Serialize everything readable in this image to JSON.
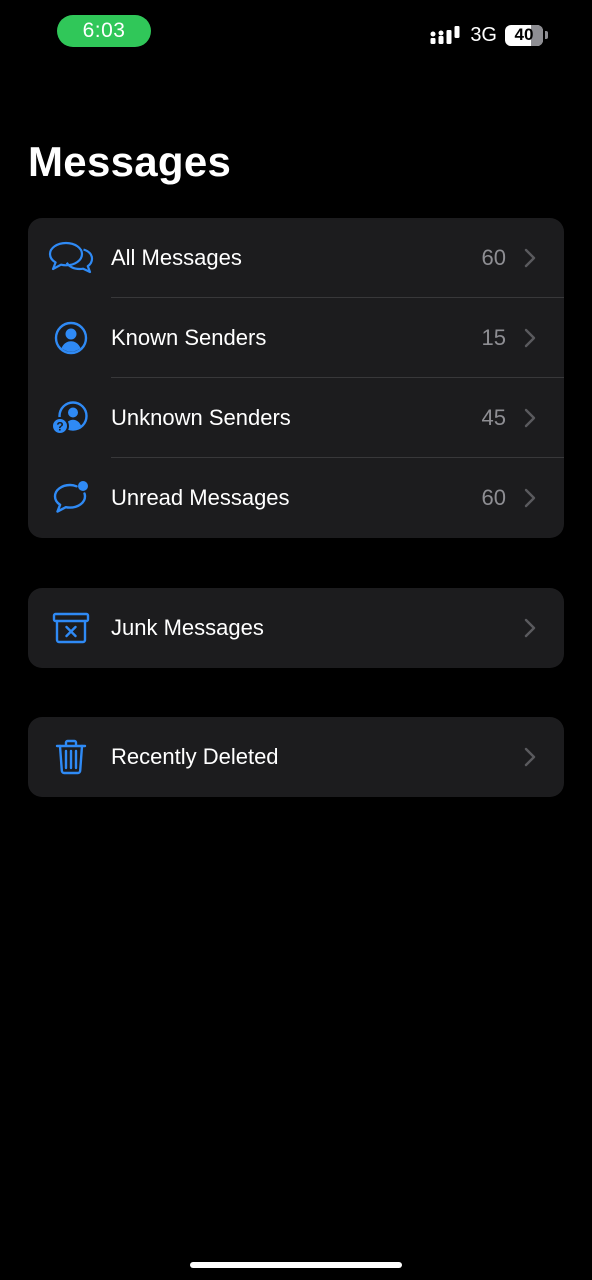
{
  "status_bar": {
    "time": "6:03",
    "network": "3G",
    "battery": "40",
    "time_pill_color": "#30c759"
  },
  "page": {
    "title": "Messages"
  },
  "filters": [
    {
      "label": "All Messages",
      "count": "60",
      "icon": "chat-bubbles-icon"
    },
    {
      "label": "Known Senders",
      "count": "15",
      "icon": "person-circle-icon"
    },
    {
      "label": "Unknown Senders",
      "count": "45",
      "icon": "person-question-icon"
    },
    {
      "label": "Unread Messages",
      "count": "60",
      "icon": "unread-bubble-icon"
    }
  ],
  "junk": {
    "label": "Junk Messages",
    "icon": "junk-box-icon"
  },
  "deleted": {
    "label": "Recently Deleted",
    "icon": "trash-icon"
  },
  "colors": {
    "accent": "#2f8af5",
    "background": "#000000",
    "group_background": "#1c1c1e",
    "secondary_text": "#8e8e93"
  }
}
